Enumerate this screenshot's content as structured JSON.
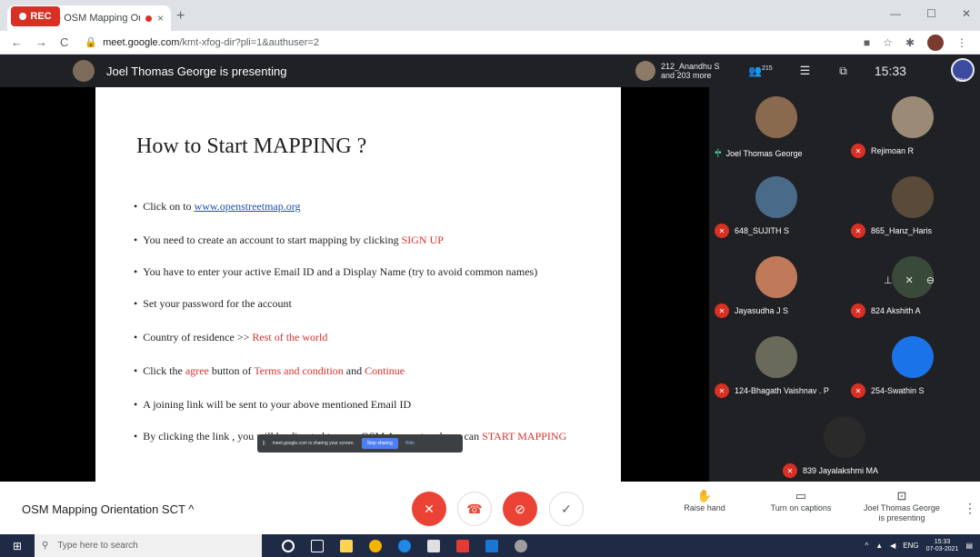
{
  "browser": {
    "tab_title": "Meet - OSM Mapping Orien",
    "tab_close": "×",
    "new_tab": "+",
    "url_domain": "meet.google.com",
    "url_path": "/kmt-xfog-dir?pli=1&authuser=2",
    "window_controls": [
      "—",
      "☐",
      "✕"
    ],
    "nav": [
      "←",
      "→",
      "C"
    ]
  },
  "meet": {
    "rec_label": "REC",
    "presenter_text": "Joel Thomas George is presenting",
    "top_people_line1": "212_Anandhu S",
    "top_people_line2": "and 203 more",
    "participant_count": "215",
    "time": "15:33",
    "you_label": "You"
  },
  "slide": {
    "title": "How to Start MAPPING ?",
    "bullets": {
      "b1_pre": "Click on to ",
      "b1_link": "www.openstreetmap.org",
      "b2_pre": "You need to create  an account to start mapping by clicking ",
      "b2_red": "SIGN UP",
      "b3": "You have to enter your active Email ID and a Display Name (try to avoid common names)",
      "b4": "Set your password for the account",
      "b5_pre": "Country of residence >> ",
      "b5_red": "Rest of the world",
      "b6_pre": "Click the ",
      "b6_red1": "agree",
      "b6_mid": " button of ",
      "b6_red2": "Terms and condition",
      "b6_and": " and  ",
      "b6_red3": "Continue",
      "b7": "A joining link will be sent to your above mentioned Email ID",
      "b8_pre": "By clicking the link , you will be directed to your OSM Account and you can ",
      "b8_red": "START MAPPING"
    },
    "share_bar": {
      "text": "meet.google.com is sharing your screen.",
      "stop": "Stop sharing",
      "hide": "Hide"
    }
  },
  "participants": [
    {
      "name": "Joel Thomas George",
      "speaking": true
    },
    {
      "name": "Rejimoan R",
      "speaking": false
    },
    {
      "name": "648_SUJITH S",
      "speaking": false
    },
    {
      "name": "865_Hanz_Haris",
      "speaking": false
    },
    {
      "name": "Jayasudha J S",
      "speaking": false
    },
    {
      "name": "824 Akshith A",
      "speaking": false
    },
    {
      "name": "124-Bhagath Vaishnav . P",
      "speaking": false
    },
    {
      "name": "254-Swathin S",
      "speaking": false
    },
    {
      "name": "839 Jayalakshmi MA",
      "speaking": false
    }
  ],
  "bottom": {
    "meeting_name": "OSM Mapping Orientation SCT",
    "raise_hand": "Raise hand",
    "captions": "Turn on captions",
    "presenting_line1": "Joel Thomas George",
    "presenting_line2": "is presenting"
  },
  "taskbar": {
    "search_placeholder": "Type here to search",
    "tray_lang": "ENG",
    "clock_time": "15:33",
    "clock_date": "07-03-2021"
  },
  "colors": {
    "accent_red": "#ea4335",
    "meet_dark": "#202124",
    "link_blue": "#1a4fb0"
  }
}
